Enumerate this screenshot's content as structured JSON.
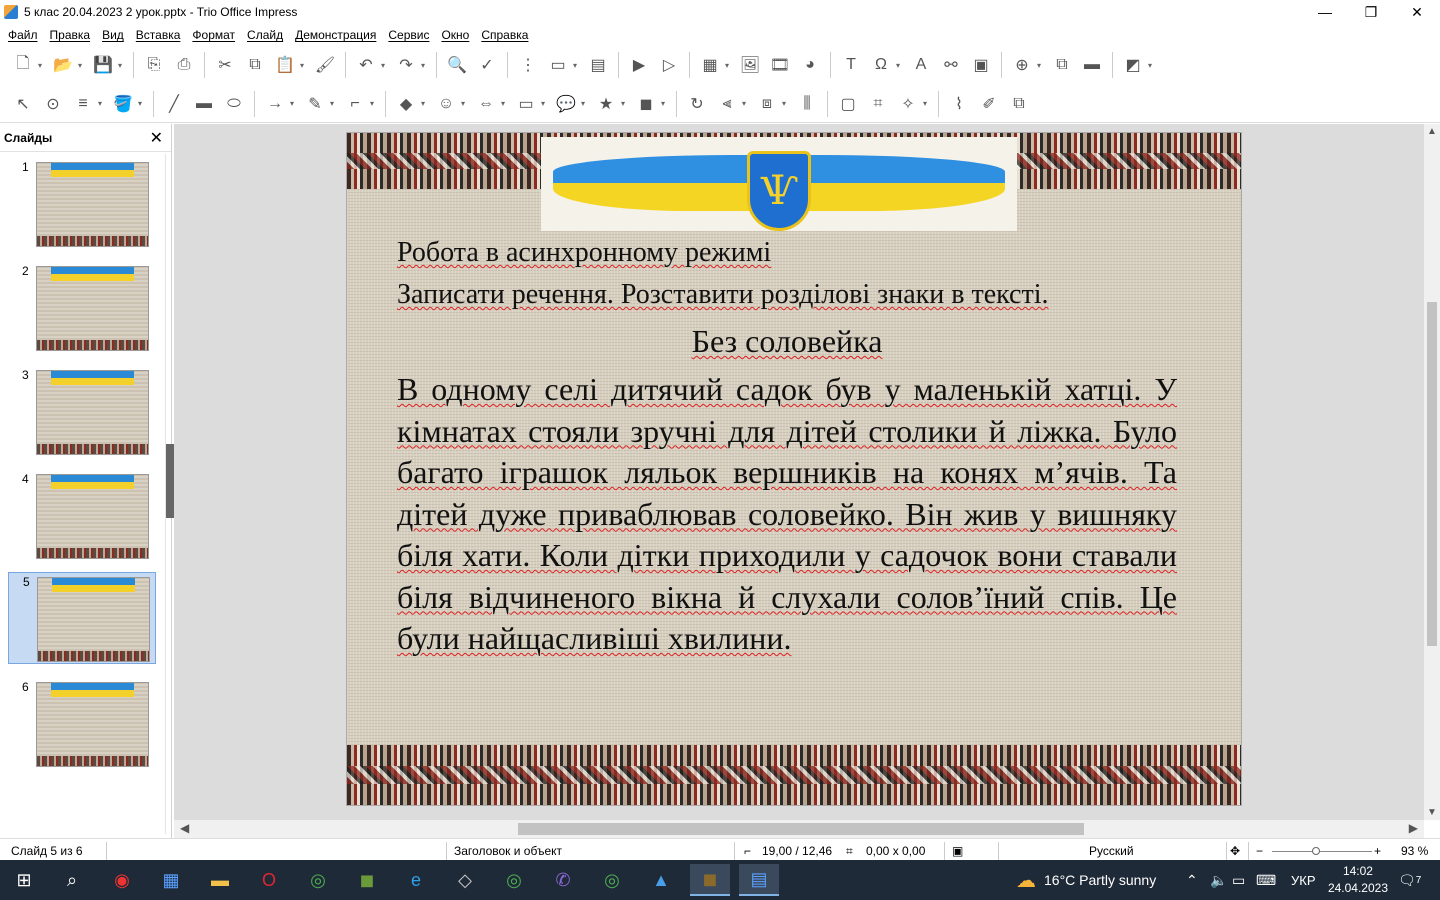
{
  "window": {
    "title": "5 клас 20.04.2023 2 урок.pptx - Trio Office Impress",
    "minimize": "—",
    "maximize": "❐",
    "close": "✕"
  },
  "menu": [
    "Файл",
    "Правка",
    "Вид",
    "Вставка",
    "Формат",
    "Слайд",
    "Демонстрация",
    "Сервис",
    "Окно",
    "Справка"
  ],
  "sidebar": {
    "title": "Слайды",
    "close": "✕",
    "slides": [
      {
        "num": "1",
        "selected": false
      },
      {
        "num": "2",
        "selected": false
      },
      {
        "num": "3",
        "selected": false
      },
      {
        "num": "4",
        "selected": false
      },
      {
        "num": "5",
        "selected": true
      },
      {
        "num": "6",
        "selected": false
      }
    ]
  },
  "slide": {
    "line1": "Робота в асинхронному режимі",
    "line2": "Записати речення. Розставити розділові знаки в тексті.",
    "heading": "Без соловейка",
    "paragraph": "В одному селі дитячий садок був у маленькій хатці. У кімнатах стояли зручні для дітей столики й ліжка. Було багато іграшок ляльок вершників на конях м’ячів. Та дітей дуже приваблював соловейко. Він жив у вишняку біля хати.  Коли дітки приходили у садочок вони ставали біля відчиненого вікна й слухали солов’їний спів. Це були найщасливіші хвилини."
  },
  "status": {
    "slide_info": "Слайд 5 из 6",
    "layout": "Заголовок и объект",
    "position": "19,00 / 12,46",
    "size": "0,00 x 0,00",
    "language": "Русский",
    "zoom": "93 %"
  },
  "taskbar": {
    "weather": "16°C  Partly sunny",
    "lang": "УКР",
    "time": "14:02",
    "date": "24.04.2023",
    "notifications": "7"
  }
}
